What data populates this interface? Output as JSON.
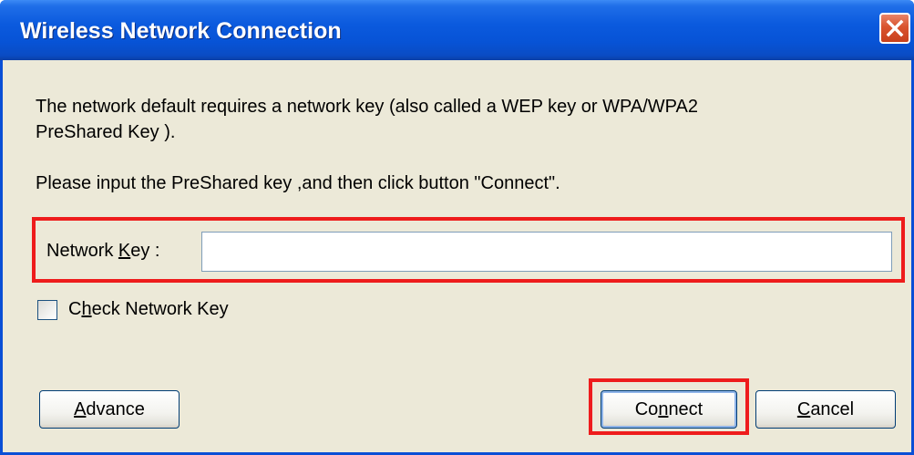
{
  "window": {
    "title": "Wireless Network Connection"
  },
  "message": {
    "line1": "The network default requires a network key (also called a WEP key or WPA/WPA2",
    "line2": "PreShared Key ).",
    "line3": "Please input the PreShared key ,and then click button \"Connect\"."
  },
  "network_key": {
    "label_pre": "Network ",
    "label_mnemonic": "K",
    "label_post": "ey :",
    "value": ""
  },
  "check_network_key": {
    "label_pre": "C",
    "label_mnemonic": "h",
    "label_post": "eck Network Key",
    "checked": false
  },
  "buttons": {
    "advance": {
      "mnemonic": "A",
      "rest": "dvance"
    },
    "connect": {
      "pre": "Co",
      "mnemonic": "n",
      "post": "nect"
    },
    "cancel": {
      "mnemonic": "C",
      "rest": "ancel"
    }
  },
  "colors": {
    "titlebar": "#0a54d9",
    "dialog_bg": "#ece9d8",
    "highlight": "#ee1c1c",
    "close_button": "#d9532e"
  },
  "icons": {
    "close": "close-icon"
  }
}
